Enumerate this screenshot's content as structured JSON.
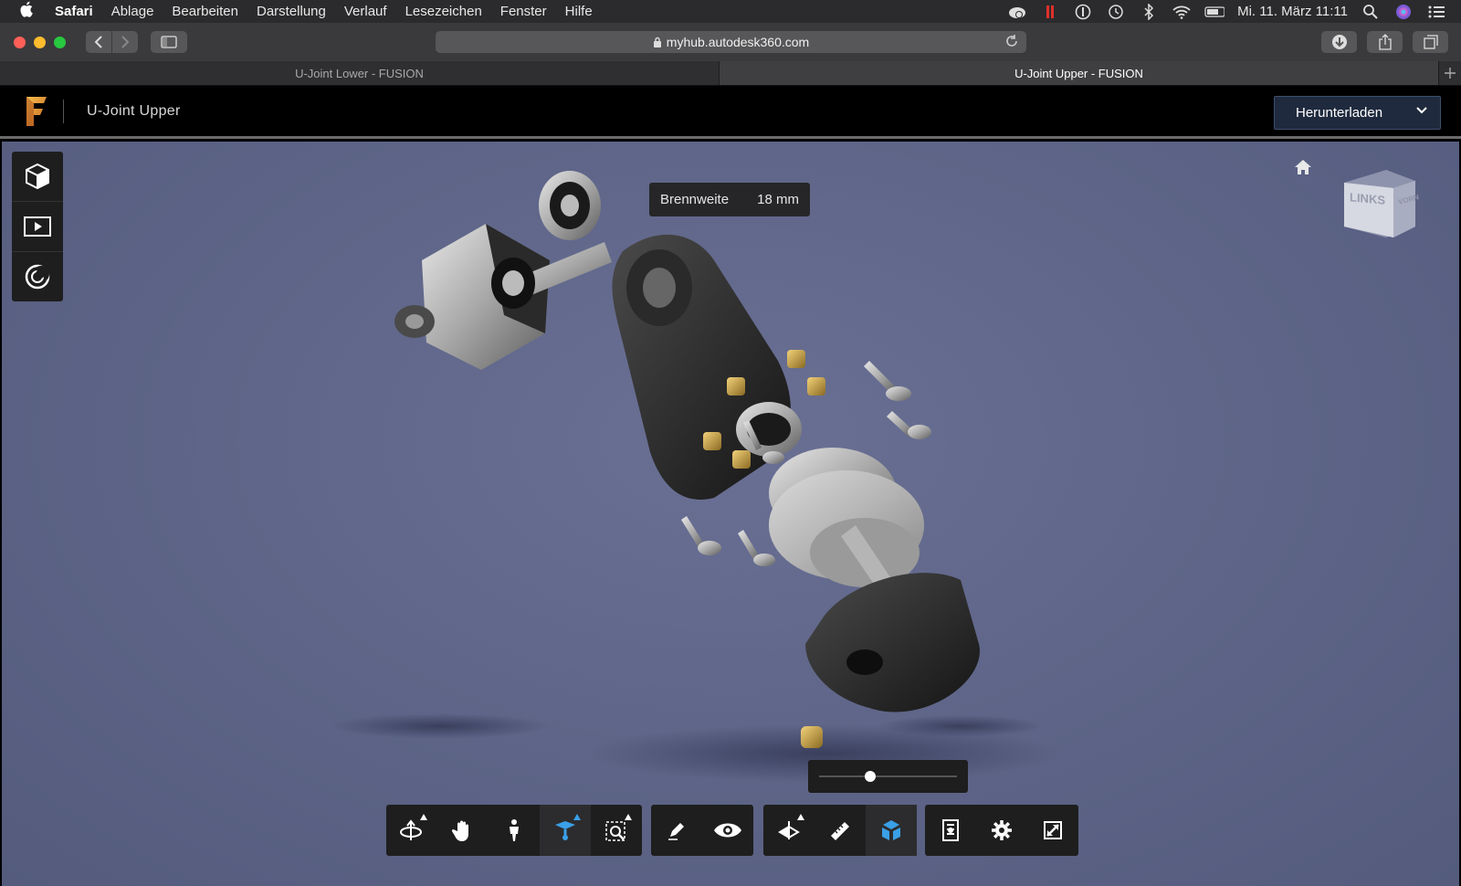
{
  "menubar": {
    "apple_icon": "apple-icon",
    "items": [
      "Safari",
      "Ablage",
      "Bearbeiten",
      "Darstellung",
      "Verlauf",
      "Lesezeichen",
      "Fenster",
      "Hilfe"
    ],
    "datetime": "Mi. 11. März  11:11"
  },
  "browser": {
    "url": "myhub.autodesk360.com",
    "tabs": [
      {
        "label": "U-Joint Lower - FUSION",
        "active": false
      },
      {
        "label": "U-Joint Upper - FUSION",
        "active": true
      }
    ],
    "traffic_colors": [
      "#ff5f57",
      "#febc2e",
      "#28c840"
    ]
  },
  "app": {
    "title": "U-Joint Upper",
    "download_label": "Herunterladen",
    "brand_color": "#e8a33d"
  },
  "viewer": {
    "tooltip_label": "Brennweite",
    "tooltip_value": "18 mm",
    "viewcube_label": "LINKS",
    "viewcube_side": "VORN",
    "slider_value": 0.37,
    "accent_color": "#3aa0e8"
  }
}
